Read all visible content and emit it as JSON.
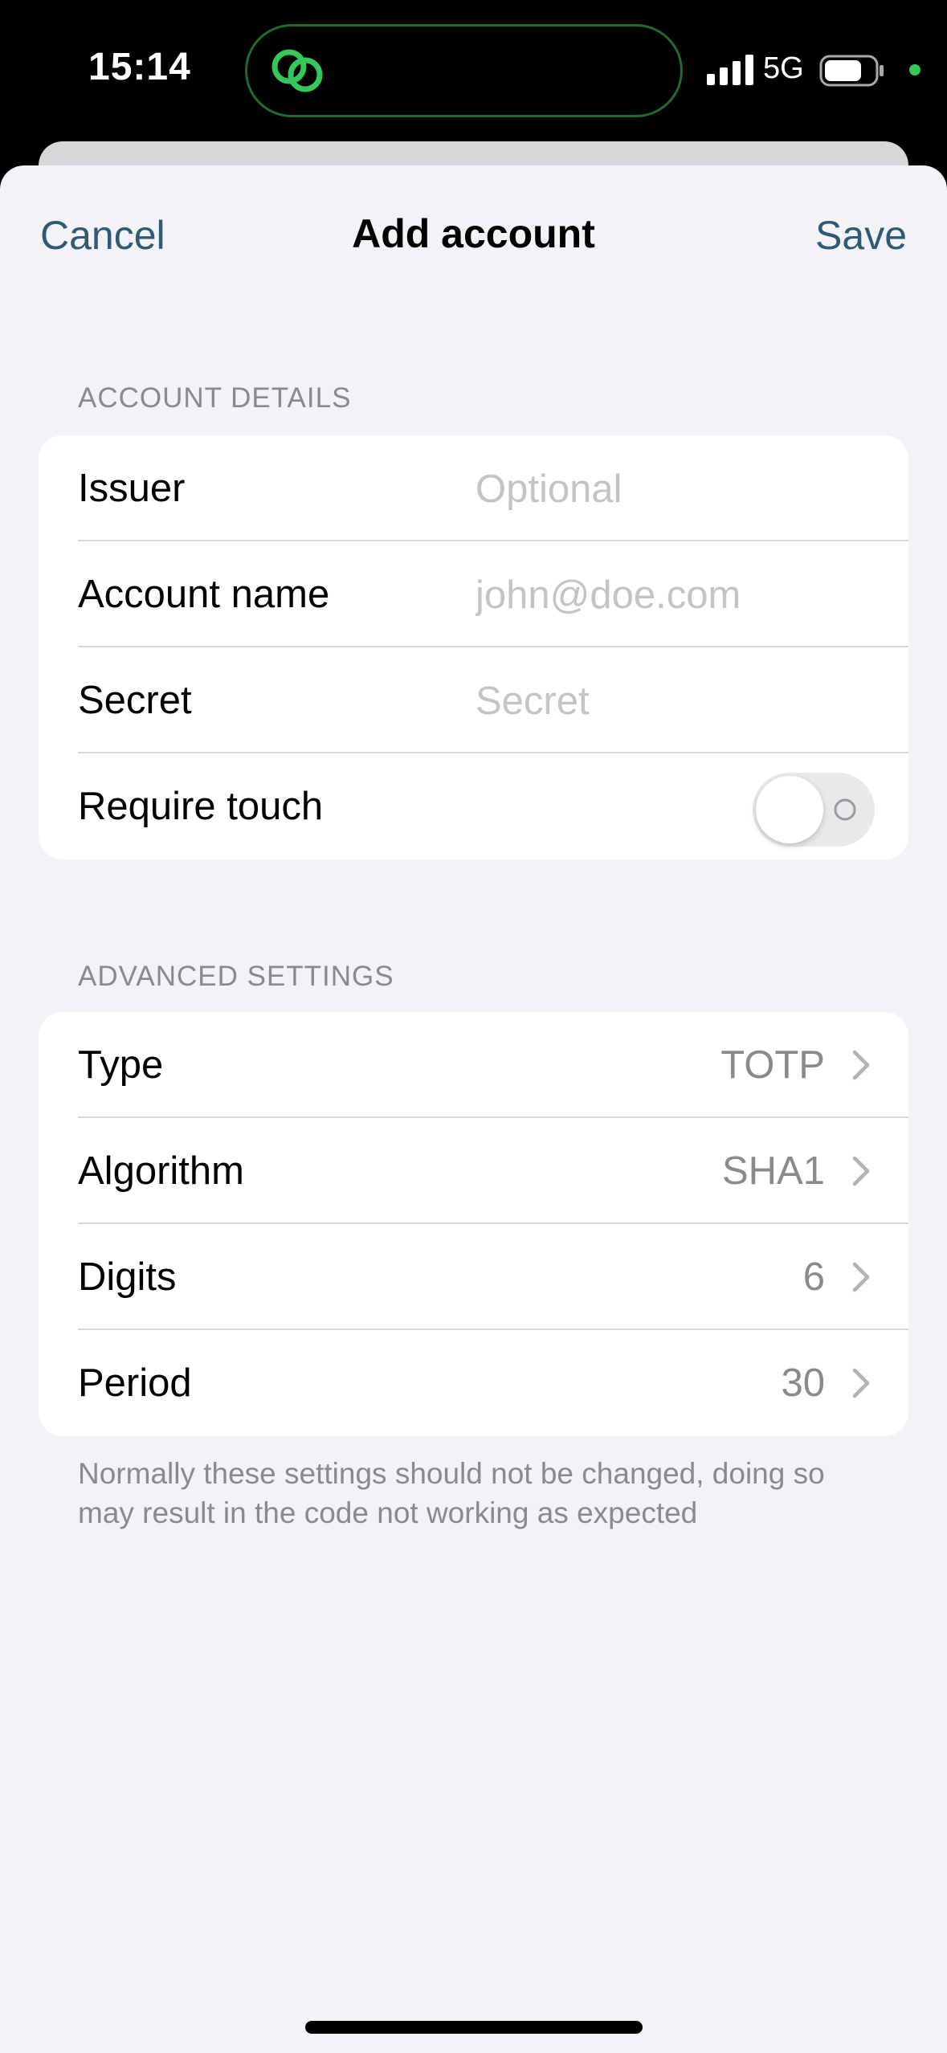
{
  "status_bar": {
    "time": "15:14",
    "network": "5G",
    "island_icon": "link-rings-icon",
    "indicator_color": "#34c759"
  },
  "nav": {
    "cancel_label": "Cancel",
    "title": "Add account",
    "save_label": "Save",
    "accent_color": "#2e5a73"
  },
  "account_details": {
    "header": "ACCOUNT DETAILS",
    "issuer": {
      "label": "Issuer",
      "value": "",
      "placeholder": "Optional"
    },
    "account_name": {
      "label": "Account name",
      "value": "",
      "placeholder": "john@doe.com"
    },
    "secret": {
      "label": "Secret",
      "value": "",
      "placeholder": "Secret"
    },
    "require_touch": {
      "label": "Require touch",
      "enabled": false
    }
  },
  "advanced_settings": {
    "header": "ADVANCED SETTINGS",
    "rows": [
      {
        "label": "Type",
        "value": "TOTP"
      },
      {
        "label": "Algorithm",
        "value": "SHA1"
      },
      {
        "label": "Digits",
        "value": "6"
      },
      {
        "label": "Period",
        "value": "30"
      }
    ],
    "footer": "Normally these settings should not be changed, doing so may result in the code not working as expected"
  }
}
